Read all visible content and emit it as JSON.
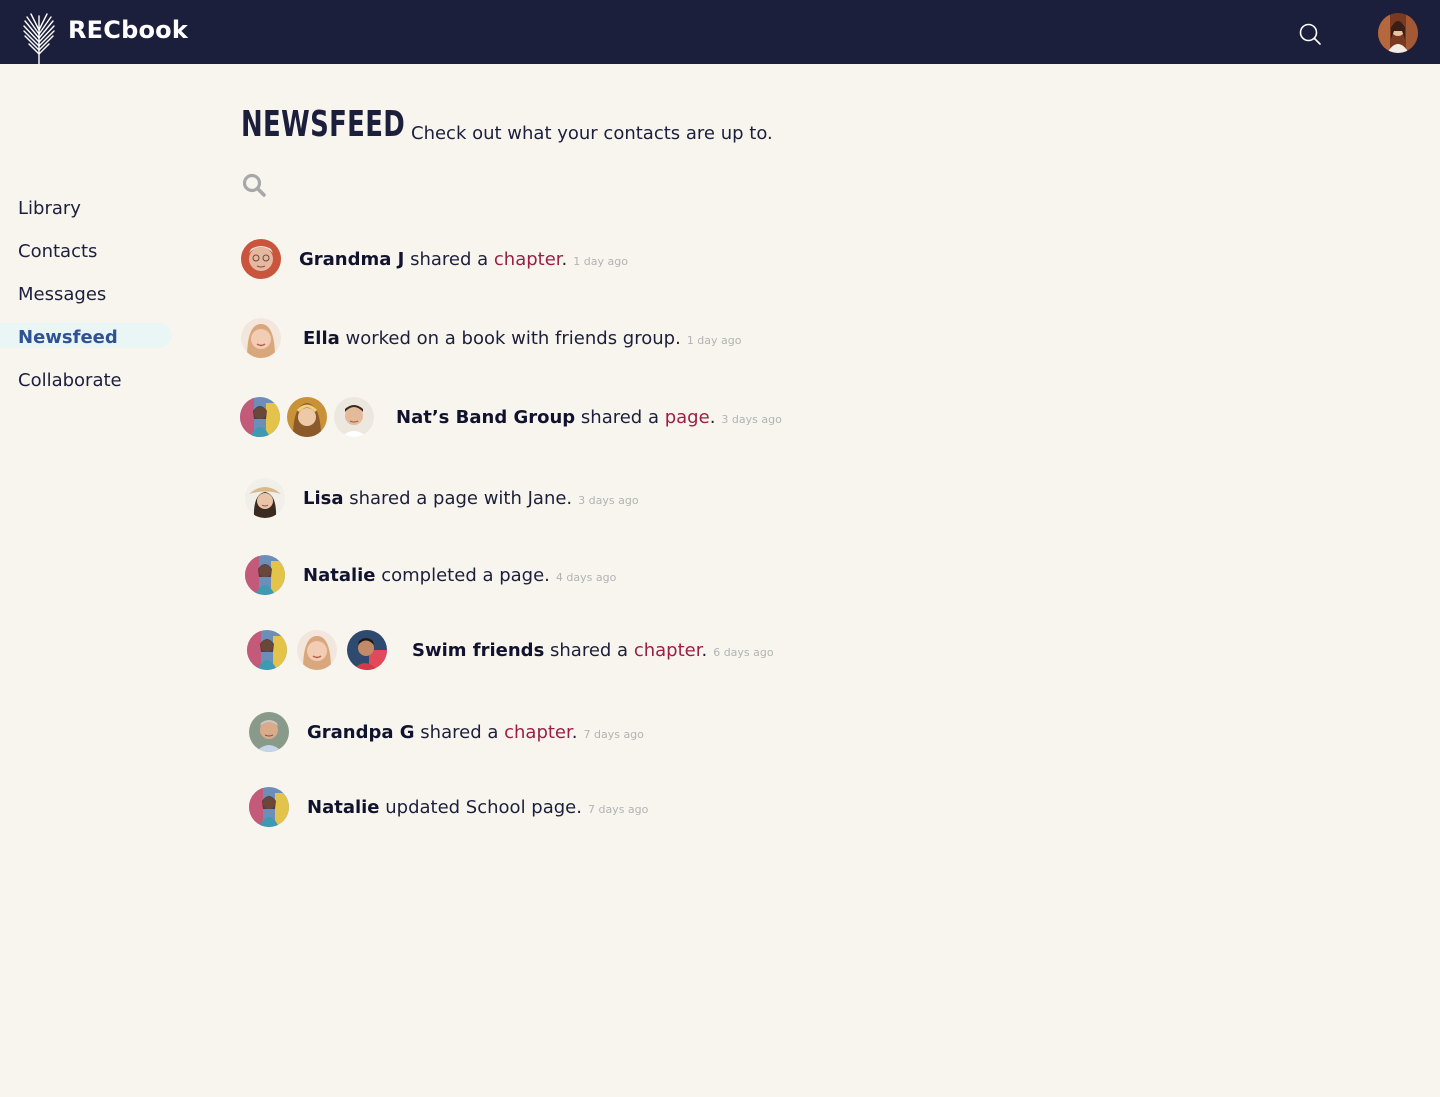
{
  "app": {
    "brand": "RECbook"
  },
  "nav": [
    {
      "label": "Library",
      "active": false
    },
    {
      "label": "Contacts",
      "active": false
    },
    {
      "label": "Messages",
      "active": false
    },
    {
      "label": "Newsfeed",
      "active": true
    },
    {
      "label": "Collaborate",
      "active": false
    }
  ],
  "page": {
    "title": "NEWSFEED",
    "subtitle": "Check out what your contacts are up to."
  },
  "feed": [
    {
      "actor": "Grandma J",
      "action": " shared a ",
      "link": "chapter",
      "end": ".",
      "time": "1 day ago",
      "avatars": [
        "grandma-j"
      ]
    },
    {
      "actor": "Ella",
      "action": " worked on a book with friends group.",
      "link": "",
      "end": "",
      "time": "1 day ago",
      "avatars": [
        "ella"
      ]
    },
    {
      "actor": "Nat’s Band Group",
      "action": " shared a ",
      "link": "page",
      "end": ".",
      "time": "3 days ago",
      "avatars": [
        "natalie",
        "girl",
        "boy"
      ]
    },
    {
      "actor": "Lisa",
      "action": " shared a page with Jane.",
      "link": "",
      "end": "",
      "time": "3 days ago",
      "avatars": [
        "lisa"
      ]
    },
    {
      "actor": "Natalie",
      "action": " completed a page.",
      "link": "",
      "end": "",
      "time": "4 days ago",
      "avatars": [
        "natalie"
      ]
    },
    {
      "actor": "Swim friends",
      "action": " shared a ",
      "link": "chapter",
      "end": ".",
      "time": "6 days ago",
      "avatars": [
        "natalie",
        "ella",
        "friend"
      ]
    },
    {
      "actor": "Grandpa G",
      "action": " shared a ",
      "link": "chapter",
      "end": ".",
      "time": "7 days ago",
      "avatars": [
        "grandpa-g"
      ]
    },
    {
      "actor": "Natalie",
      "action": " updated School page.",
      "link": "",
      "end": "",
      "time": "7 days ago",
      "avatars": [
        "natalie"
      ]
    }
  ],
  "colors": {
    "topbar": "#1c1f3b",
    "background": "#f8f5ef",
    "link": "#9a1f45",
    "active_nav": "#2f5294"
  }
}
